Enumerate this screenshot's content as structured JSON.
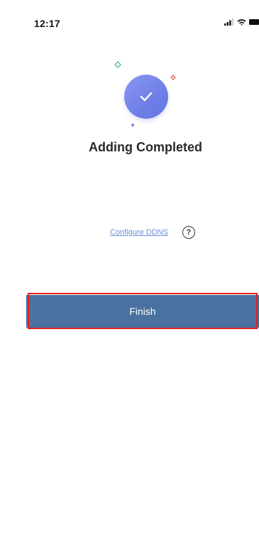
{
  "status_bar": {
    "time": "12:17",
    "icons": [
      "signal-icon",
      "wifi-icon",
      "battery-icon"
    ]
  },
  "success": {
    "icon": "checkmark-icon",
    "title": "Adding Completed",
    "accent_color": "#7080e8"
  },
  "ddns": {
    "link_label": "Configure DDNS",
    "help_icon": "help-icon",
    "help_label": "?"
  },
  "actions": {
    "finish_label": "Finish",
    "finish_color": "#4a71a0",
    "highlight_color": "#e02020"
  }
}
